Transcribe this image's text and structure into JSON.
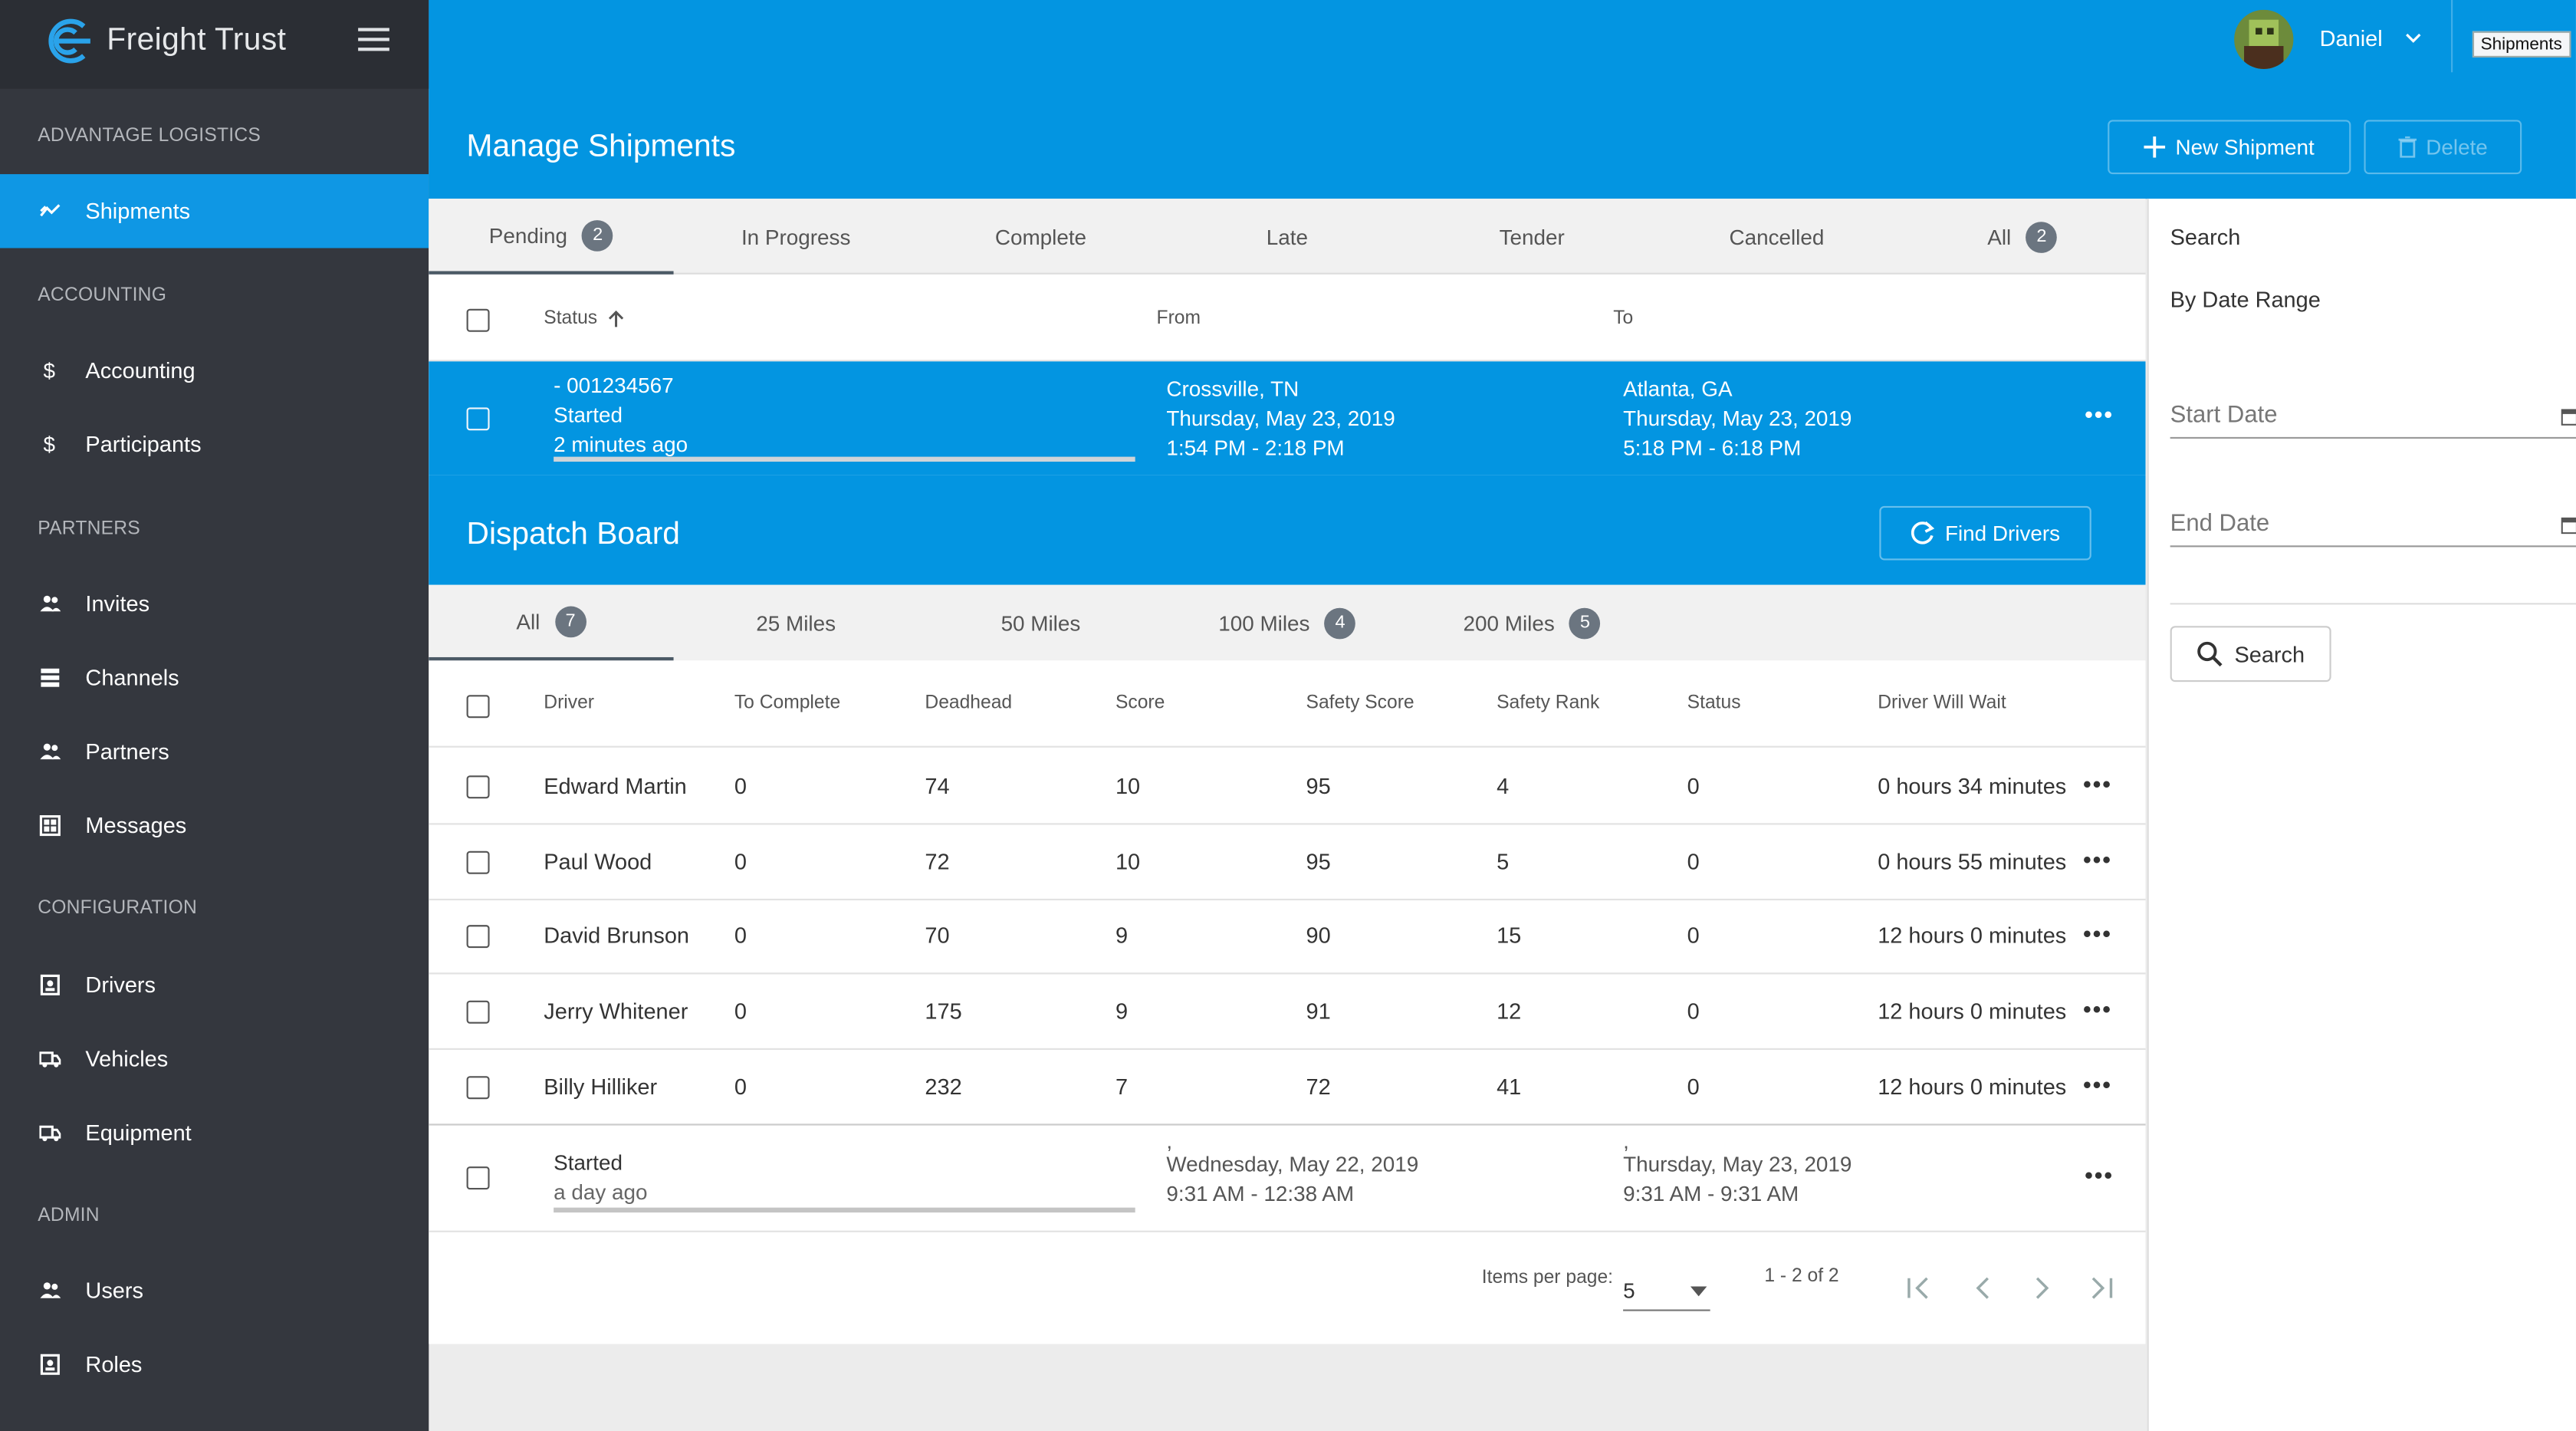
{
  "brand": {
    "name": "Freight Trust",
    "logo_icon": "freight-trust-logo",
    "menu_icon": "hamburger-icon"
  },
  "sidebar": {
    "org": "ADVANTAGE LOGISTICS",
    "sections": [
      {
        "title": "ACCOUNTING"
      },
      {
        "title": "PARTNERS"
      },
      {
        "title": "CONFIGURATION"
      },
      {
        "title": "ADMIN"
      }
    ],
    "items": [
      {
        "label": "Shipments",
        "icon": "trend-icon"
      },
      {
        "label": "Accounting",
        "icon": "dollar-icon"
      },
      {
        "label": "Participants",
        "icon": "dollar-icon"
      },
      {
        "label": "Invites",
        "icon": "people-icon"
      },
      {
        "label": "Channels",
        "icon": "list-icon"
      },
      {
        "label": "Partners",
        "icon": "people-icon"
      },
      {
        "label": "Messages",
        "icon": "grid-icon"
      },
      {
        "label": "Drivers",
        "icon": "id-card-icon"
      },
      {
        "label": "Vehicles",
        "icon": "truck-icon"
      },
      {
        "label": "Equipment",
        "icon": "truck-icon"
      },
      {
        "label": "Users",
        "icon": "people-icon"
      },
      {
        "label": "Roles",
        "icon": "id-card-icon"
      }
    ]
  },
  "header": {
    "title": "Manage Shipments",
    "user": "Daniel",
    "tooltip": "Shipments",
    "new_shipment": "New Shipment",
    "delete": "Delete"
  },
  "shipment_tabs": [
    {
      "label": "Pending",
      "badge": "2"
    },
    {
      "label": "In Progress"
    },
    {
      "label": "Complete"
    },
    {
      "label": "Late"
    },
    {
      "label": "Tender"
    },
    {
      "label": "Cancelled"
    },
    {
      "label": "All",
      "badge": "2"
    }
  ],
  "shipment_columns": {
    "status": "Status",
    "from": "From",
    "to": "To"
  },
  "shipments": [
    {
      "id": "- 001234567",
      "status": "Started",
      "ago": "2 minutes ago",
      "from_city": "Crossville, TN",
      "from_date": "Thursday, May 23, 2019",
      "from_time": "1:54 PM - 2:18 PM",
      "to_city": "Atlanta, GA",
      "to_date": "Thursday, May 23, 2019",
      "to_time": "5:18 PM - 6:18 PM"
    },
    {
      "status": "Started",
      "ago": "a day ago",
      "from_city": ",",
      "from_date": "Wednesday, May 22, 2019",
      "from_time": "9:31 AM - 12:38 AM",
      "to_city": ",",
      "to_date": "Thursday, May 23, 2019",
      "to_time": "9:31 AM - 9:31 AM"
    }
  ],
  "dispatch": {
    "title": "Dispatch Board",
    "find_drivers": "Find Drivers",
    "tabs": [
      {
        "label": "All",
        "badge": "7"
      },
      {
        "label": "25 Miles"
      },
      {
        "label": "50 Miles"
      },
      {
        "label": "100 Miles",
        "badge": "4"
      },
      {
        "label": "200 Miles",
        "badge": "5"
      }
    ],
    "columns": [
      "Driver",
      "To Complete",
      "Deadhead",
      "Score",
      "Safety Score",
      "Safety Rank",
      "Status",
      "Driver Will Wait"
    ],
    "rows": [
      [
        "Edward Martin",
        "0",
        "74",
        "10",
        "95",
        "4",
        "0",
        "0 hours 34 minutes"
      ],
      [
        "Paul Wood",
        "0",
        "72",
        "10",
        "95",
        "5",
        "0",
        "0 hours 55 minutes"
      ],
      [
        "David Brunson",
        "0",
        "70",
        "9",
        "90",
        "15",
        "0",
        "12 hours 0 minutes"
      ],
      [
        "Jerry Whitener",
        "0",
        "175",
        "9",
        "91",
        "12",
        "0",
        "12 hours 0 minutes"
      ],
      [
        "Billy Hilliker",
        "0",
        "232",
        "7",
        "72",
        "41",
        "0",
        "12 hours 0 minutes"
      ]
    ]
  },
  "paginator": {
    "items_label": "Items per page:",
    "per_page": "5",
    "range": "1 - 2 of 2"
  },
  "search_panel": {
    "title": "Search",
    "by_date": "By Date Range",
    "start_placeholder": "Start Date",
    "end_placeholder": "End Date",
    "button": "Search"
  },
  "colors": {
    "accent": "#0395e1",
    "sidebar": "#34373e",
    "sidebar_header": "#2b2e34",
    "active_item": "#0f97e4"
  }
}
